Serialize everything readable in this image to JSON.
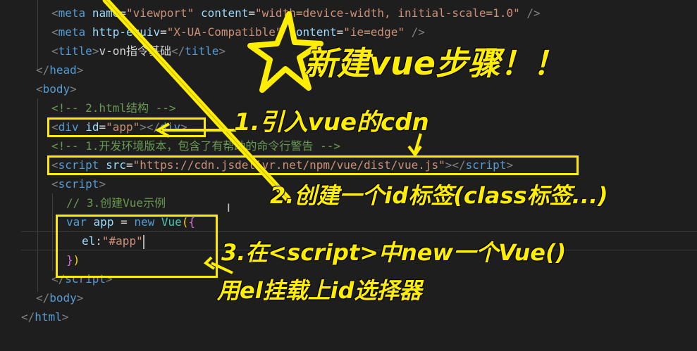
{
  "code": {
    "line1": {
      "open": "<",
      "tag": "meta",
      "a1": "name",
      "eq": "=",
      "v1": "\"viewport\"",
      "a2": "content",
      "v2": "\"width=device-width, initial-scale=1.0\"",
      "close": "/>"
    },
    "line2": {
      "open": "<",
      "tag": "meta",
      "a1": "http-equiv",
      "eq": "=",
      "v1": "\"X-UA-Compatible\"",
      "a2": "content",
      "v2": "\"ie=edge\"",
      "close": "/>"
    },
    "line3": {
      "open": "<",
      "tag": "title",
      "close": ">",
      "text": "v-on指令基础",
      "end_open": "</",
      "end_close": ">"
    },
    "line4": {
      "open": "</",
      "tag": "head",
      "close": ">"
    },
    "line5": {
      "open": "<",
      "tag": "body",
      "close": ">"
    },
    "line6": {
      "comment": "<!-- 2.html结构 -->"
    },
    "line7": {
      "open": "<",
      "tag": "div",
      "attr": "id",
      "eq": "=",
      "val": "\"app\"",
      "close": ">",
      "end_open": "</",
      "end_close": ">"
    },
    "line8": {
      "comment": "<!-- 1.开发环境版本，包含了有帮助的命令行警告 -->"
    },
    "line9": {
      "open": "<",
      "tag": "script",
      "attr": "src",
      "eq": "=",
      "val": "\"https://cdn.jsdelivr.net/npm/vue/dist/vue.js\"",
      "close": ">",
      "end_open": "</",
      "end_close": ">"
    },
    "line10": {
      "open": "<",
      "tag": "script",
      "close": ">"
    },
    "line11": {
      "comment": "// 3.创建Vue示例"
    },
    "line12": {
      "kw": "var",
      "name": "app",
      "op": " = ",
      "new": "new",
      "cls": "Vue",
      "paren": "(",
      "brace": "{"
    },
    "line13": {
      "prop": "el",
      "colon": ":",
      "val": "\"#app\""
    },
    "line14": {
      "brace": "}",
      "paren": ")"
    },
    "line15": {
      "open": "</",
      "tag": "script",
      "close": ">"
    },
    "line16": {
      "open": "</",
      "tag": "body",
      "close": ">"
    },
    "line17": {
      "open": "</",
      "tag": "html",
      "close": ">"
    }
  },
  "annotations": {
    "title": "新建vue步骤！！",
    "step1": "1.引入vue的cdn",
    "step2": "2.创建一个id标签(class标签...)",
    "step3_line1": "3.在<script>中new一个Vue()",
    "step3_line2": "用el挂载上id选择器"
  },
  "colors": {
    "highlight": "#ffeb00",
    "background": "#1e1e1e"
  }
}
